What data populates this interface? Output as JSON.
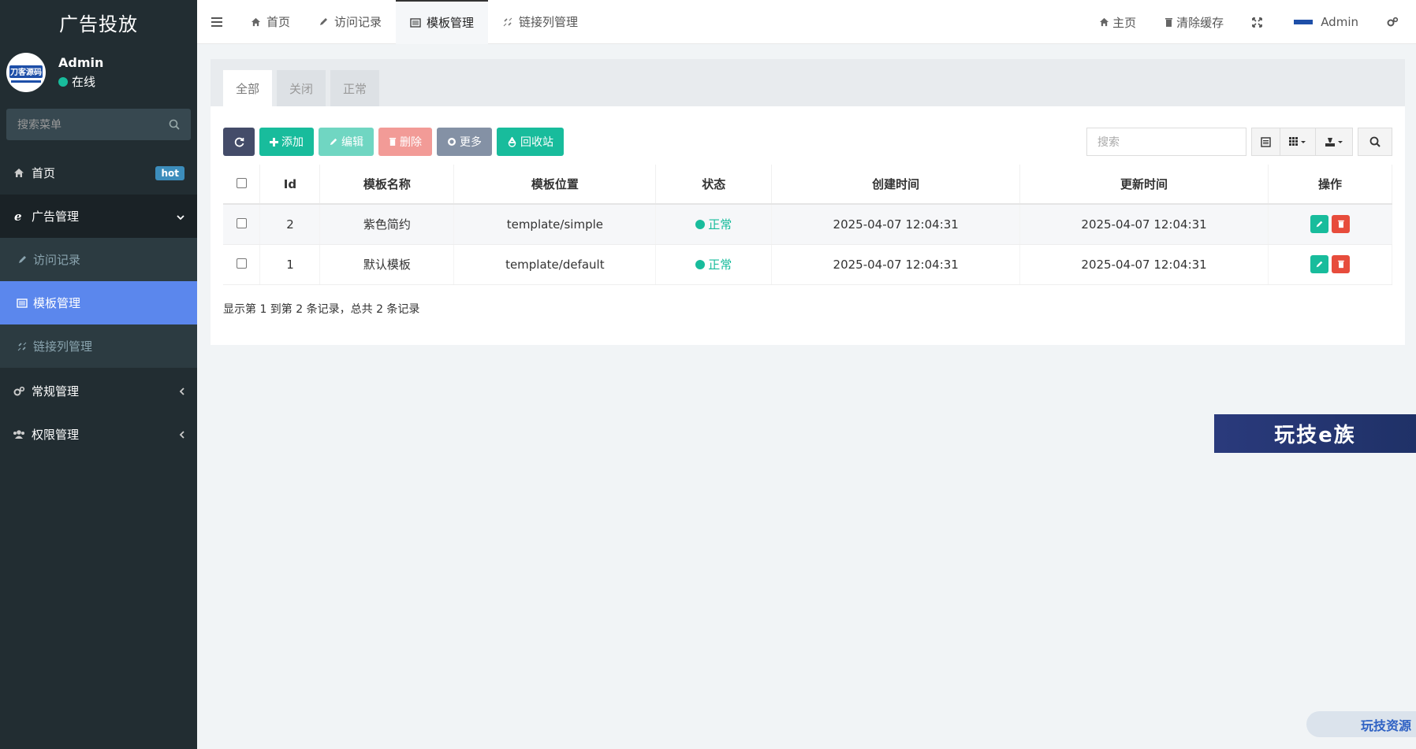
{
  "app": {
    "title": "广告投放"
  },
  "user": {
    "name": "Admin",
    "status": "在线",
    "avatar_text": "刀客源码"
  },
  "sidebar": {
    "search_placeholder": "搜索菜单",
    "items": [
      {
        "label": "首页",
        "badge": "hot"
      },
      {
        "label": "广告管理"
      },
      {
        "label": "访问记录"
      },
      {
        "label": "模板管理"
      },
      {
        "label": "链接列管理"
      },
      {
        "label": "常规管理"
      },
      {
        "label": "权限管理"
      }
    ]
  },
  "topnav": {
    "tabs": [
      {
        "label": "首页"
      },
      {
        "label": "访问记录"
      },
      {
        "label": "模板管理"
      },
      {
        "label": "链接列管理"
      }
    ],
    "right": {
      "home": "主页",
      "clear_cache": "清除缓存",
      "admin": "Admin"
    }
  },
  "panel": {
    "tabs": [
      {
        "label": "全部"
      },
      {
        "label": "关闭"
      },
      {
        "label": "正常"
      }
    ],
    "toolbar": {
      "add": "添加",
      "edit": "编辑",
      "delete": "删除",
      "more": "更多",
      "recycle": "回收站",
      "search_placeholder": "搜索"
    },
    "table": {
      "headers": [
        "Id",
        "模板名称",
        "模板位置",
        "状态",
        "创建时间",
        "更新时间",
        "操作"
      ],
      "rows": [
        {
          "id": "2",
          "name": "紫色简约",
          "path": "template/simple",
          "status": "正常",
          "created": "2025-04-07 12:04:31",
          "updated": "2025-04-07 12:04:31"
        },
        {
          "id": "1",
          "name": "默认模板",
          "path": "template/default",
          "status": "正常",
          "created": "2025-04-07 12:04:31",
          "updated": "2025-04-07 12:04:31"
        }
      ]
    },
    "summary": "显示第 1 到第 2 条记录，总共 2 条记录"
  },
  "watermarks": {
    "banner": "玩技e族",
    "corner": "玩技资源"
  },
  "colors": {
    "sidebar_bg": "#222d32",
    "active_menu": "#5b87ed",
    "success": "#18bc9c",
    "danger": "#e74c3c"
  }
}
